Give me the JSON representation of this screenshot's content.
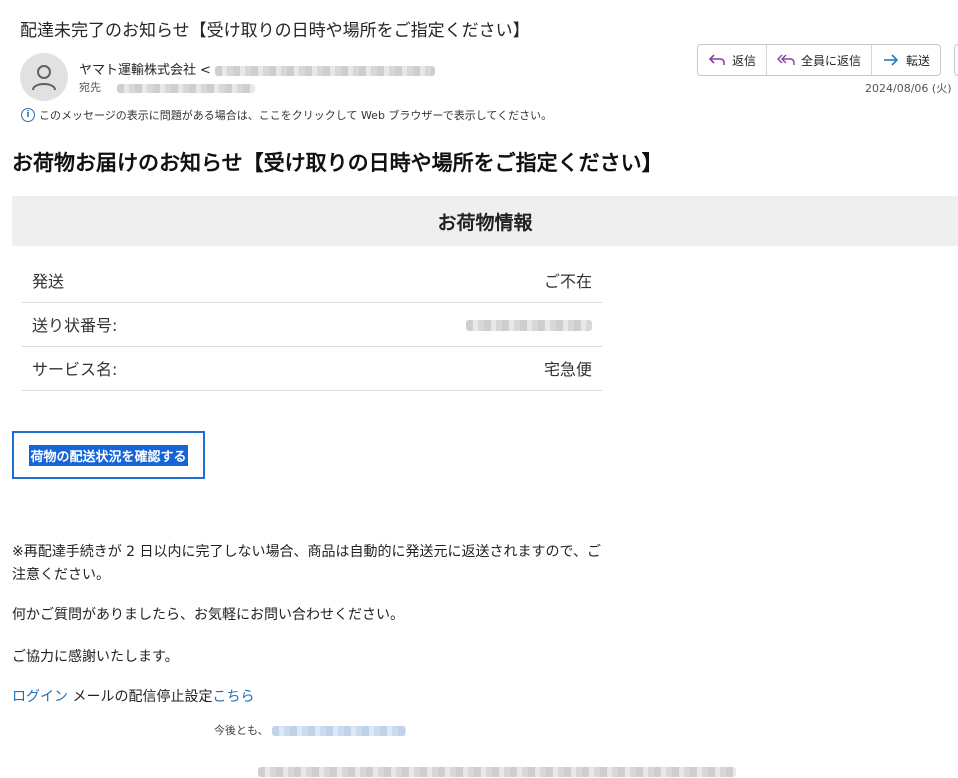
{
  "email": {
    "subject": "配達未完了のお知らせ【受け取りの日時や場所をご指定ください】",
    "sender_name": "ヤマト運輸株式会社",
    "sender_lt": "<",
    "to_label": "宛先",
    "date": "2024/08/06 (火)",
    "info_notice": "このメッセージの表示に問題がある場合は、ここをクリックして Web ブラウザーで表示してください。"
  },
  "toolbar": {
    "reply_label": "返信",
    "reply_all_label": "全員に返信",
    "forward_label": "転送"
  },
  "body": {
    "headline": "お荷物お届けのお知らせ【受け取りの日時や場所をご指定ください】",
    "section_title": "お荷物情報",
    "rows": [
      {
        "label": "発送",
        "value": "ご不在"
      },
      {
        "label": "送り状番号:",
        "value": ""
      },
      {
        "label": "サービス名:",
        "value": "宅急便"
      }
    ],
    "track_button": "荷物の配送状況を確認する",
    "notice": "※再配達手続きが 2 日以内に完了しない場合、商品は自動的に発送元に返送されますので、ご注意ください。",
    "question": "何かご質問がありましたら、お気軽にお問い合わせください。",
    "thanks": "ご協力に感謝いたします。",
    "login_link": "ログイン",
    "unsubscribe_text": " メールの配信停止設定",
    "here_link": "こちら",
    "footer_prefix": "今後とも、"
  },
  "icons": {
    "avatar": "person-icon",
    "reply": "reply-arrow-icon",
    "reply_all": "reply-all-arrow-icon",
    "forward": "forward-arrow-icon",
    "info": "info-icon"
  },
  "colors": {
    "accent_purple": "#8a3fa8",
    "link_blue": "#1f6fb8",
    "button_blue": "#1565d8"
  }
}
